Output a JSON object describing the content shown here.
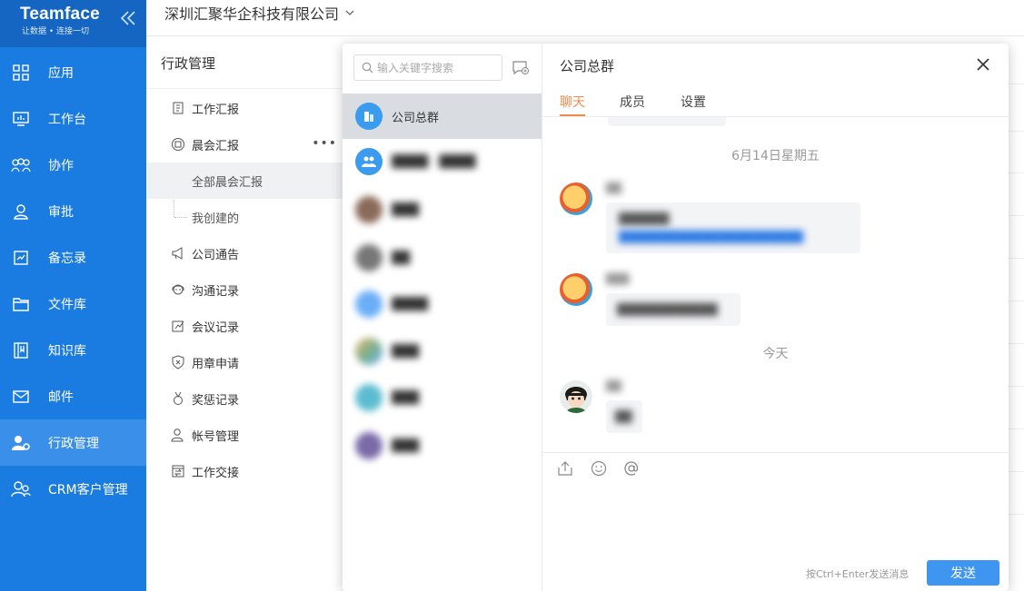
{
  "brand": {
    "name": "Teamface",
    "slogan": "让数据 • 连接一切"
  },
  "nav": {
    "items": [
      {
        "label": "应用",
        "icon": "apps-icon"
      },
      {
        "label": "工作台",
        "icon": "workbench-icon"
      },
      {
        "label": "协作",
        "icon": "collaboration-icon"
      },
      {
        "label": "审批",
        "icon": "approval-icon"
      },
      {
        "label": "备忘录",
        "icon": "memo-icon"
      },
      {
        "label": "文件库",
        "icon": "folder-icon"
      },
      {
        "label": "知识库",
        "icon": "knowledge-icon"
      },
      {
        "label": "邮件",
        "icon": "mail-icon"
      },
      {
        "label": "行政管理",
        "icon": "admin-icon",
        "active": true
      },
      {
        "label": "CRM客户管理",
        "icon": "crm-icon"
      }
    ]
  },
  "header": {
    "company": "深圳汇聚华企科技有限公司"
  },
  "submenu": {
    "title": "行政管理",
    "items": [
      {
        "label": "工作汇报",
        "icon": "report-icon"
      },
      {
        "label": "晨会汇报",
        "icon": "morning-meeting-icon"
      },
      {
        "label": "全部晨会汇报",
        "child": true,
        "active": true
      },
      {
        "label": "我创建的",
        "child": true
      },
      {
        "label": "公司通告",
        "icon": "megaphone-icon"
      },
      {
        "label": "沟通记录",
        "icon": "headset-icon"
      },
      {
        "label": "会议记录",
        "icon": "meeting-note-icon"
      },
      {
        "label": "用章申请",
        "icon": "seal-icon"
      },
      {
        "label": "奖惩记录",
        "icon": "medal-icon"
      },
      {
        "label": "帐号管理",
        "icon": "account-icon"
      },
      {
        "label": "工作交接",
        "icon": "handover-icon"
      }
    ],
    "more": "•••"
  },
  "chat": {
    "search_placeholder": "输入关键字搜索",
    "conversations": [
      {
        "name": "公司总群",
        "active": true,
        "avatar_color": "#3a9bef"
      },
      {
        "name": "████ · ████",
        "blurred": true,
        "avatar_color": "#3a9bef"
      },
      {
        "name": "███",
        "blurred": true,
        "avatar_color": "#8a6a58"
      },
      {
        "name": "██",
        "blurred": true,
        "avatar_color": "#777777"
      },
      {
        "name": "████",
        "blurred": true,
        "avatar_color": "#6aaef7"
      },
      {
        "name": "███",
        "blurred": true,
        "avatar_color": "#7cb08a"
      },
      {
        "name": "███",
        "blurred": true,
        "avatar_color": "#5bbcd0"
      },
      {
        "name": "███",
        "blurred": true,
        "avatar_color": "#7a6aa8"
      }
    ],
    "title": "公司总群",
    "tabs": [
      "聊天",
      "成员",
      "设置"
    ],
    "date_1": "6月14日星期五",
    "date_2": "今天",
    "messages": [
      {
        "sender": "██",
        "text": "██████",
        "link": "██████████████████████"
      },
      {
        "sender": "███",
        "text": "████████████"
      },
      {
        "sender": "██",
        "text": "██"
      }
    ],
    "send_hint": "按Ctrl+Enter发送消息",
    "send_label": "发送"
  },
  "colors": {
    "nav_bg": "#1a7be0",
    "nav_active": "#3a8fe8",
    "accent": "#f08a4b",
    "send": "#3f96f0"
  }
}
